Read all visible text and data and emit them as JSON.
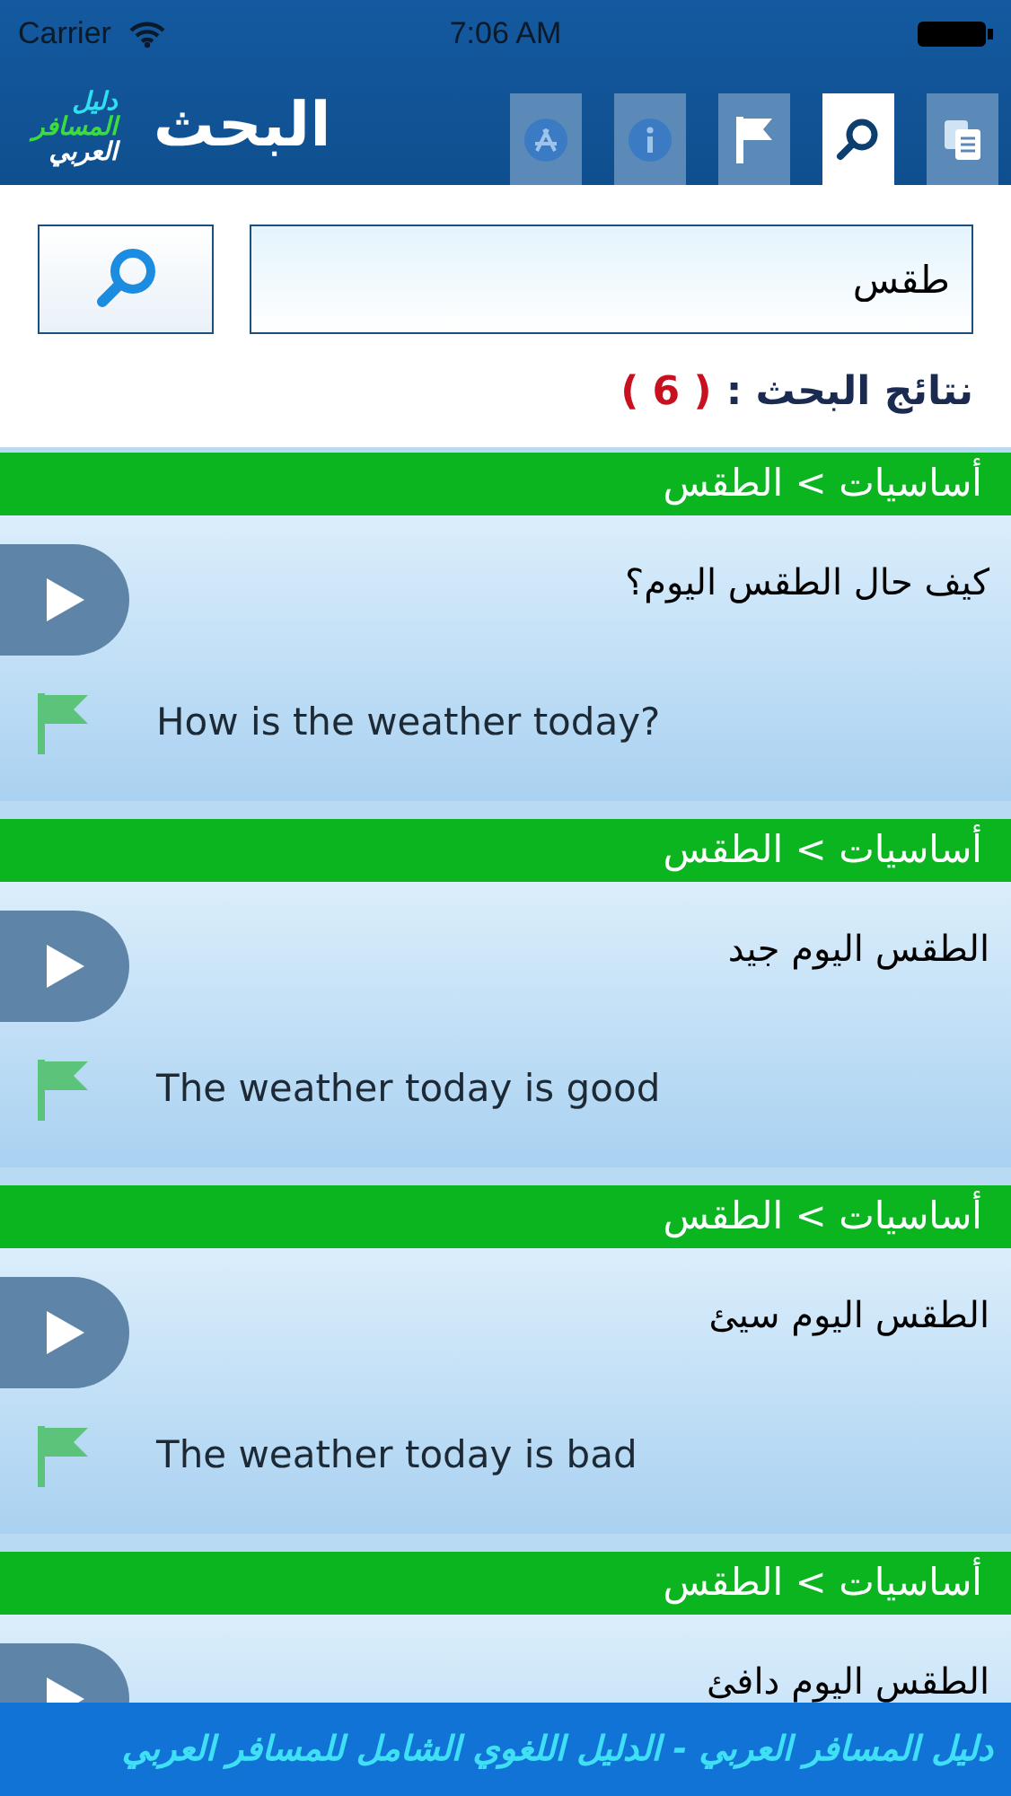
{
  "status_bar": {
    "carrier": "Carrier",
    "time": "7:06 AM"
  },
  "header": {
    "logo_lines": [
      "دليل",
      "المسافر",
      "العربي"
    ],
    "title": "البحث",
    "tabs": [
      {
        "kind": "store",
        "selected": false
      },
      {
        "kind": "info",
        "selected": false
      },
      {
        "kind": "flag",
        "selected": false
      },
      {
        "kind": "search",
        "selected": true
      },
      {
        "kind": "pages",
        "selected": false
      }
    ]
  },
  "search": {
    "value": "طقس"
  },
  "results_label": "نتائج البحث :",
  "results_count": "( 6 )",
  "results": [
    {
      "category": "أساسيات > الطقس",
      "arabic": "كيف حال الطقس اليوم؟",
      "english": "How is the weather today?"
    },
    {
      "category": "أساسيات > الطقس",
      "arabic": "الطقس اليوم جيد",
      "english": "The weather today is good"
    },
    {
      "category": "أساسيات > الطقس",
      "arabic": "الطقس اليوم سيئ",
      "english": "The weather today is bad"
    },
    {
      "category": "أساسيات > الطقس",
      "arabic": "الطقس اليوم دافئ"
    }
  ],
  "banner": "دليل المسافر العربي - الدليل اللغوي الشامل للمسافر العربي"
}
